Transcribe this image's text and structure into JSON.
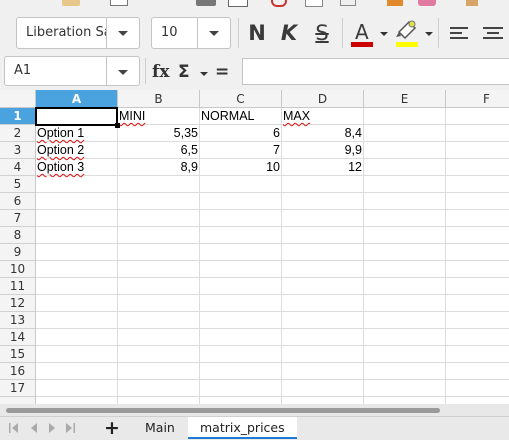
{
  "toolbar": {
    "font_name": "Liberation Sa",
    "font_size": "10",
    "bold_label": "N",
    "italic_label": "K",
    "strikethrough_label": "S",
    "font_color_label": "A",
    "font_color": "#cc0000",
    "highlight_color": "#ffff00"
  },
  "formula_bar": {
    "name_box": "A1",
    "fx_label": "fx",
    "sum_label": "Σ",
    "equals_label": "=",
    "content": ""
  },
  "sheet": {
    "columns": [
      "A",
      "B",
      "C",
      "D",
      "E",
      "F"
    ],
    "rows": [
      "1",
      "2",
      "3",
      "4",
      "5",
      "6",
      "7",
      "8",
      "9",
      "10",
      "11",
      "12",
      "13",
      "14",
      "15",
      "16",
      "17"
    ],
    "selected_cell": "A1",
    "cells": {
      "b1": "MINI",
      "c1": "NORMAL",
      "d1": "MAX",
      "a2": "Option 1",
      "b2": "5,35",
      "c2": "6",
      "d2": "8,4",
      "a3": "Option 2",
      "b3": "6,5",
      "c3": "7",
      "d3": "9,9",
      "a4": "Option 3",
      "b4": "8,9",
      "c4": "10",
      "d4": "12"
    }
  },
  "tabs": {
    "add_label": "+",
    "items": [
      "Main",
      "matrix_prices"
    ],
    "active": "matrix_prices"
  },
  "colors": {
    "selection": "#4aa3df",
    "active_tab_underline": "#1e7ad6",
    "spellcheck": "#dd1111"
  }
}
